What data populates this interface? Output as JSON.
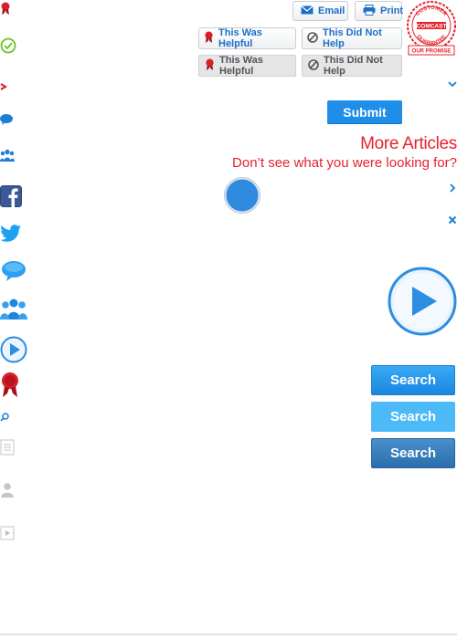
{
  "toolbar": {
    "email_label": "Email",
    "print_label": "Print"
  },
  "badge": {
    "top_text": "CUSTOMER",
    "brand": "COMCAST",
    "bottom_text": "GUARANTEE",
    "ribbon": "OUR PROMISE"
  },
  "feedback": {
    "helpful_label": "This Was Helpful",
    "not_helpful_label": "This Did Not Help",
    "helpful_label_2": "This Was Helpful",
    "not_helpful_label_2": "This Did Not Help"
  },
  "form": {
    "submit_label": "Submit"
  },
  "articles": {
    "heading": "More Articles",
    "subheading": "Don’t see what you were looking for?"
  },
  "search": {
    "label_1": "Search",
    "label_2": "Search",
    "label_3": "Search"
  },
  "colors": {
    "accent_blue": "#1f8ee8",
    "brand_red": "#e4232d",
    "link_blue": "#1a6fc7"
  },
  "icons": [
    "ribbon-icon",
    "check-circle-icon",
    "chevron-right-icon",
    "chat-bubble-icon",
    "people-icon",
    "facebook-icon",
    "twitter-icon",
    "chat-bubble-large-icon",
    "people-large-icon",
    "play-circle-icon",
    "ribbon-large-icon",
    "search-magnifier-icon",
    "document-icon",
    "user-icon",
    "video-file-icon",
    "chevron-down-icon",
    "chevron-right-icon",
    "close-icon",
    "play-large-icon",
    "blue-dot-icon"
  ]
}
